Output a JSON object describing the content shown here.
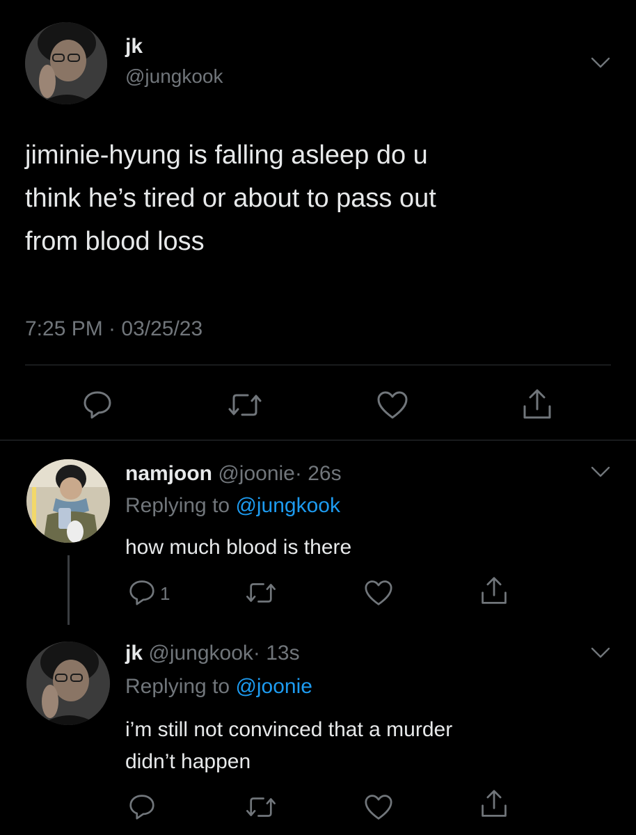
{
  "main_tweet": {
    "display_name": "jk",
    "handle": "@jungkook",
    "text_lines": [
      "jiminie-hyung is falling asleep do u",
      "think he’s tired or about to pass out",
      "from blood loss"
    ],
    "timestamp": "7:25 PM · 03/25/23"
  },
  "replies": [
    {
      "display_name": "namjoon",
      "handle": "@joonie",
      "time": "· 26s",
      "replying_label": "Replying to",
      "replying_to": "@jungkook",
      "text_lines": [
        "how much blood is there"
      ],
      "reply_count": "1"
    },
    {
      "display_name": "jk",
      "handle": "@jungkook",
      "time": "· 13s",
      "replying_label": "Replying to",
      "replying_to": "@joonie",
      "text_lines": [
        "i’m still not convinced that a murder",
        "didn’t happen"
      ],
      "reply_count": ""
    }
  ],
  "colors": {
    "background": "#000000",
    "text": "#e7e9ea",
    "muted": "#71767b",
    "link": "#1d9bf0"
  },
  "icons": [
    "reply-icon",
    "retweet-icon",
    "like-icon",
    "share-icon",
    "chevron-down-icon"
  ]
}
